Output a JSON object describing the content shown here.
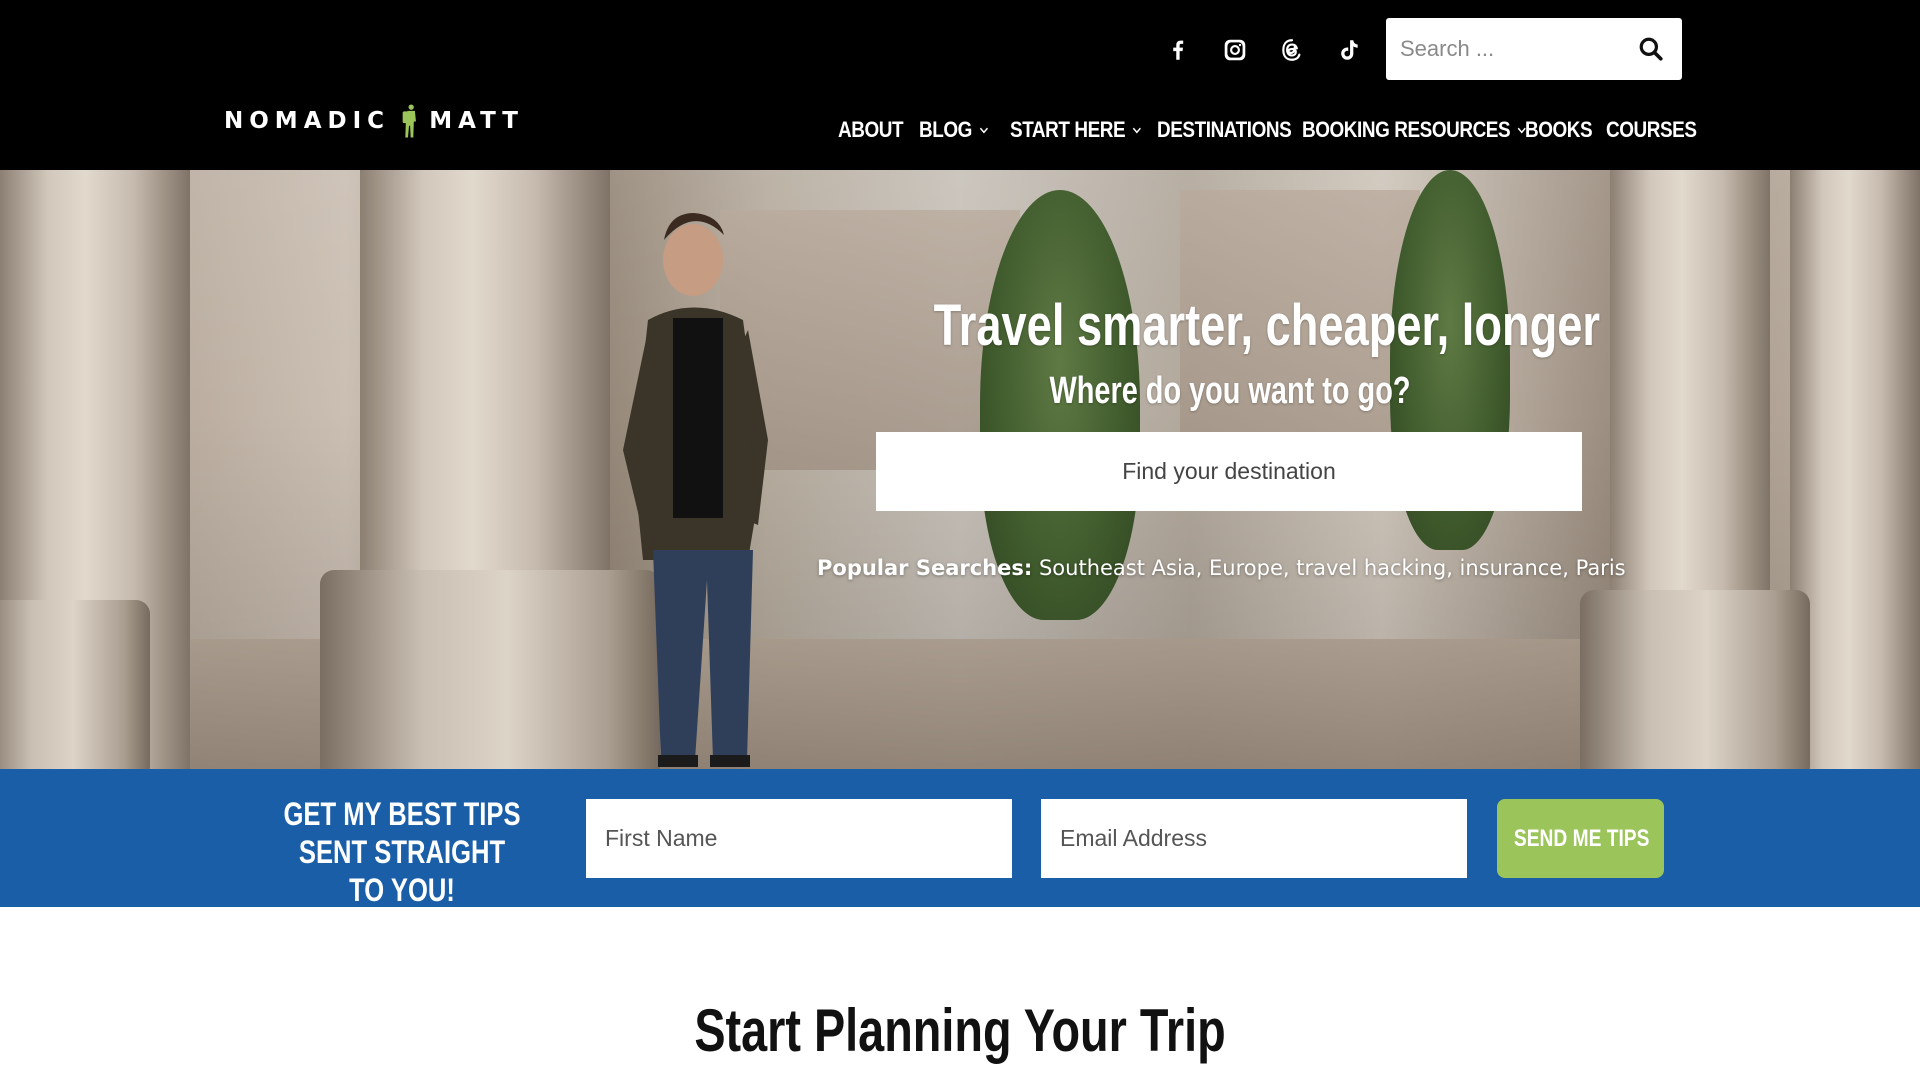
{
  "brand": {
    "logo_text_left": "NOMADIC",
    "logo_text_right": "MATT"
  },
  "colors": {
    "header_bg": "#000000",
    "signup_bg": "#1a5ea8",
    "button_green": "#9bc45b"
  },
  "social": [
    {
      "name": "facebook-icon"
    },
    {
      "name": "instagram-icon"
    },
    {
      "name": "threads-icon"
    },
    {
      "name": "tiktok-icon"
    }
  ],
  "search": {
    "placeholder": "Search ..."
  },
  "nav": {
    "about": "ABOUT",
    "blog": "BLOG",
    "start_here": "START HERE",
    "destinations": "DESTINATIONS",
    "booking_resources": "BOOKING RESOURCES",
    "books": "BOOKS",
    "courses": "COURSES"
  },
  "hero": {
    "title": "Travel smarter, cheaper, longer",
    "subtitle": "Where do you want to go?",
    "destination_placeholder": "Find your destination",
    "popular_label": "Popular Searches:",
    "popular": [
      "Southeast Asia",
      "Europe",
      "travel hacking",
      "insurance",
      "Paris"
    ]
  },
  "signup": {
    "text": "GET MY BEST TIPS SENT STRAIGHT TO YOU!",
    "first_name_placeholder": "First Name",
    "email_placeholder": "Email Address",
    "button": "SEND ME TIPS"
  },
  "planning": {
    "title": "Start Planning Your Trip"
  }
}
